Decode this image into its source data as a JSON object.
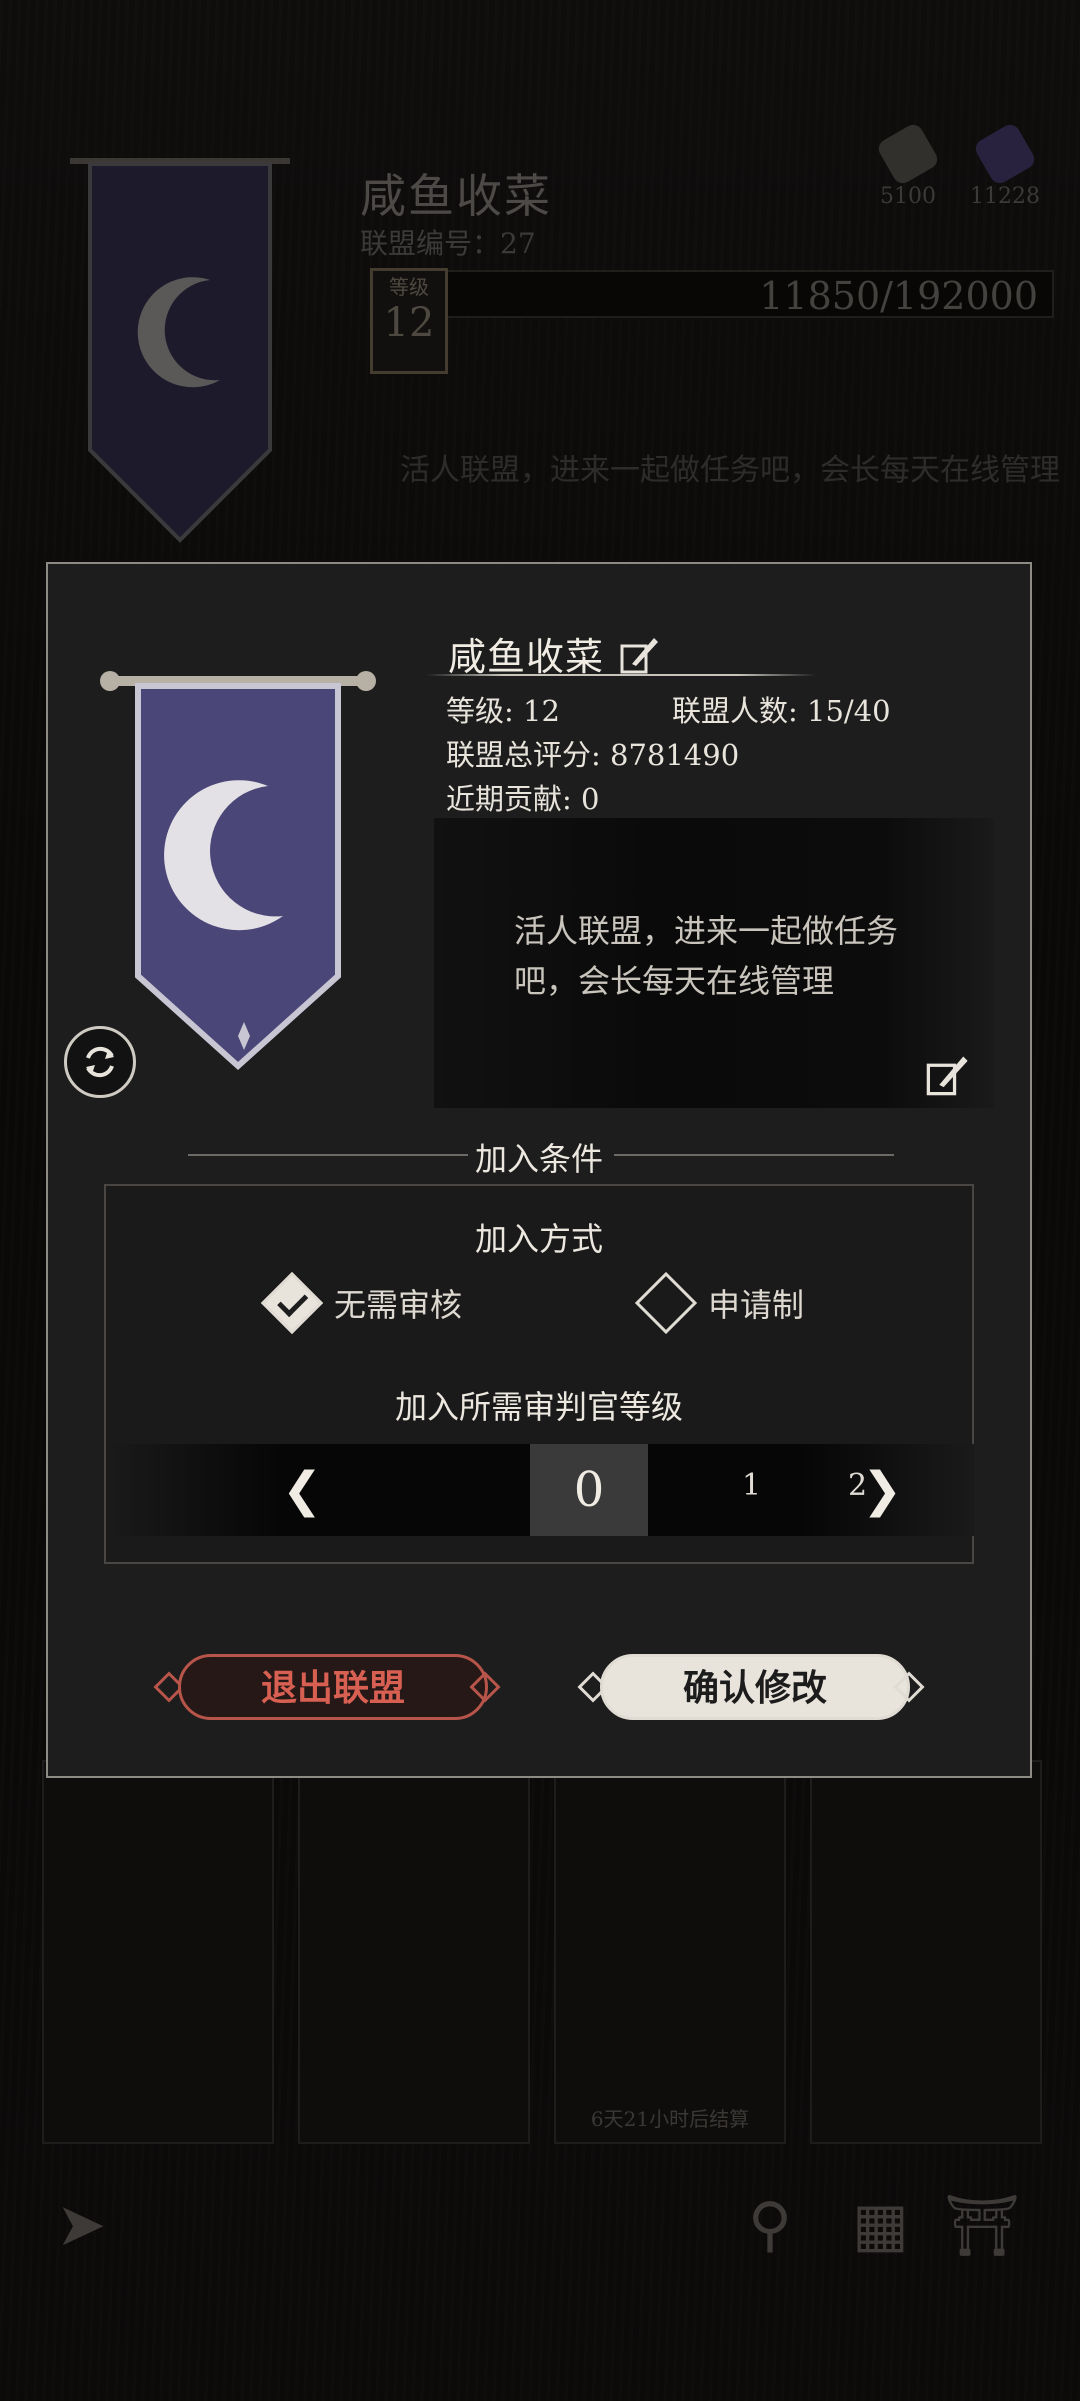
{
  "background": {
    "guild_name": "咸鱼收菜",
    "guild_id_label": "联盟编号：27",
    "level": "12",
    "level_label": "等级",
    "exp_text": "11850/192000",
    "exp_fraction": 0.062,
    "description": "活人联盟，进来一起做任务吧，会长每天在线管理",
    "currency_1": "5100",
    "currency_2": "11228",
    "card_caption": "6天21小时后结算"
  },
  "dialog": {
    "guild_name": "咸鱼收菜",
    "level_label": "等级:",
    "level_value": "12",
    "members_label": "联盟人数:",
    "members_value": "15/40",
    "score_label": "联盟总评分:",
    "score_value": "8781490",
    "contribution_label": "近期贡献:",
    "contribution_value": "0",
    "description": "活人联盟，进来一起做任务吧，会长每天在线管理",
    "join_conditions_title": "加入条件",
    "join_method_title": "加入方式",
    "option_no_review": "无需审核",
    "option_application": "申请制",
    "selected_option": "无需审核",
    "rank_title": "加入所需审判官等级",
    "rank_current": "0",
    "rank_next_1": "1",
    "rank_next_2": "2",
    "quit_button": "退出联盟",
    "confirm_button": "确认修改"
  },
  "colors": {
    "quit": "#d76052",
    "banner": "#4a4677",
    "panel": "#1d1d1d"
  }
}
